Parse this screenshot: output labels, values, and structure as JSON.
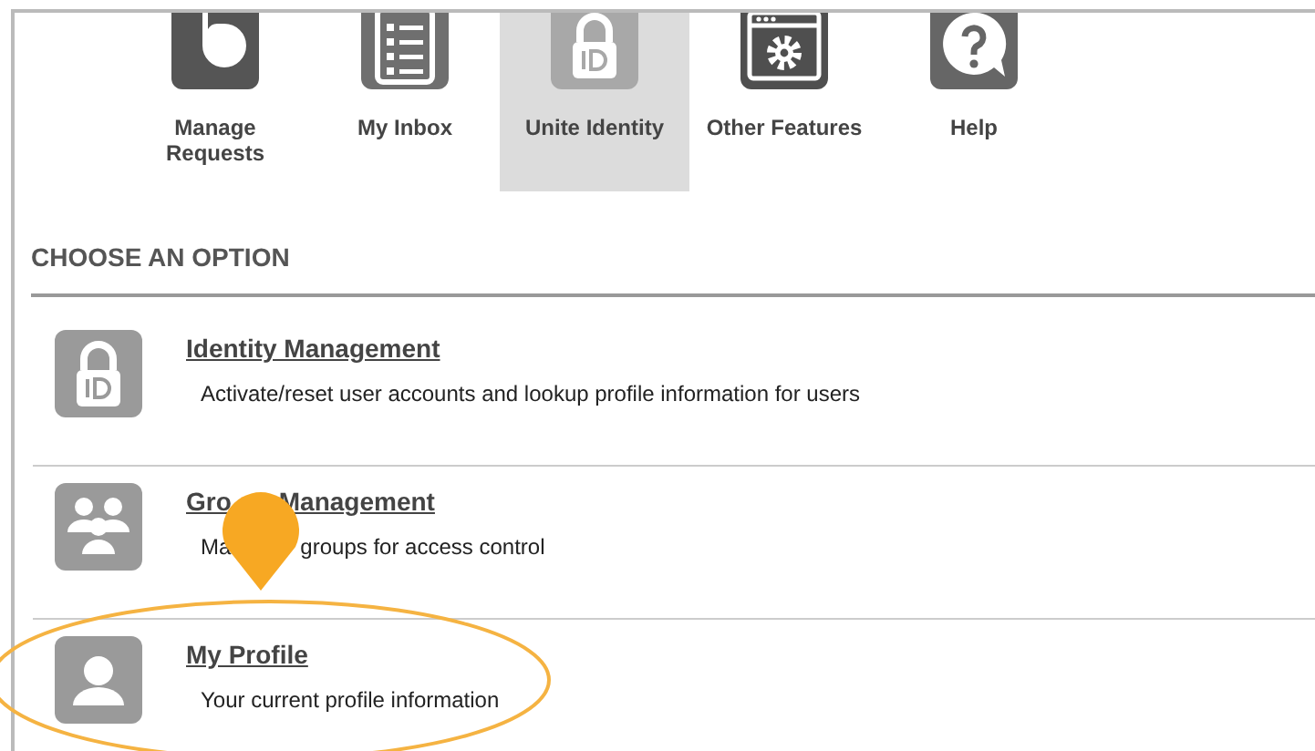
{
  "nav": [
    {
      "label": "Manage Requests",
      "kind": "requests",
      "selected": false
    },
    {
      "label": "My Inbox",
      "kind": "inbox",
      "selected": false
    },
    {
      "label": "Unite Identity",
      "kind": "id",
      "selected": true
    },
    {
      "label": "Other Features",
      "kind": "features",
      "selected": false
    },
    {
      "label": "Help",
      "kind": "help",
      "selected": false
    }
  ],
  "section_title": "CHOOSE AN OPTION",
  "options": [
    {
      "title": [
        "Identity Management"
      ],
      "description": [
        "Activate/reset user accounts and lookup profile information for users"
      ],
      "kind": "id"
    },
    {
      "title": [
        "Gro",
        "Management"
      ],
      "description": [
        "Ma",
        "groups for access control"
      ],
      "kind": "group"
    },
    {
      "title": [
        "My Profile"
      ],
      "description": [
        "Your current profile information"
      ],
      "kind": "profile"
    }
  ]
}
